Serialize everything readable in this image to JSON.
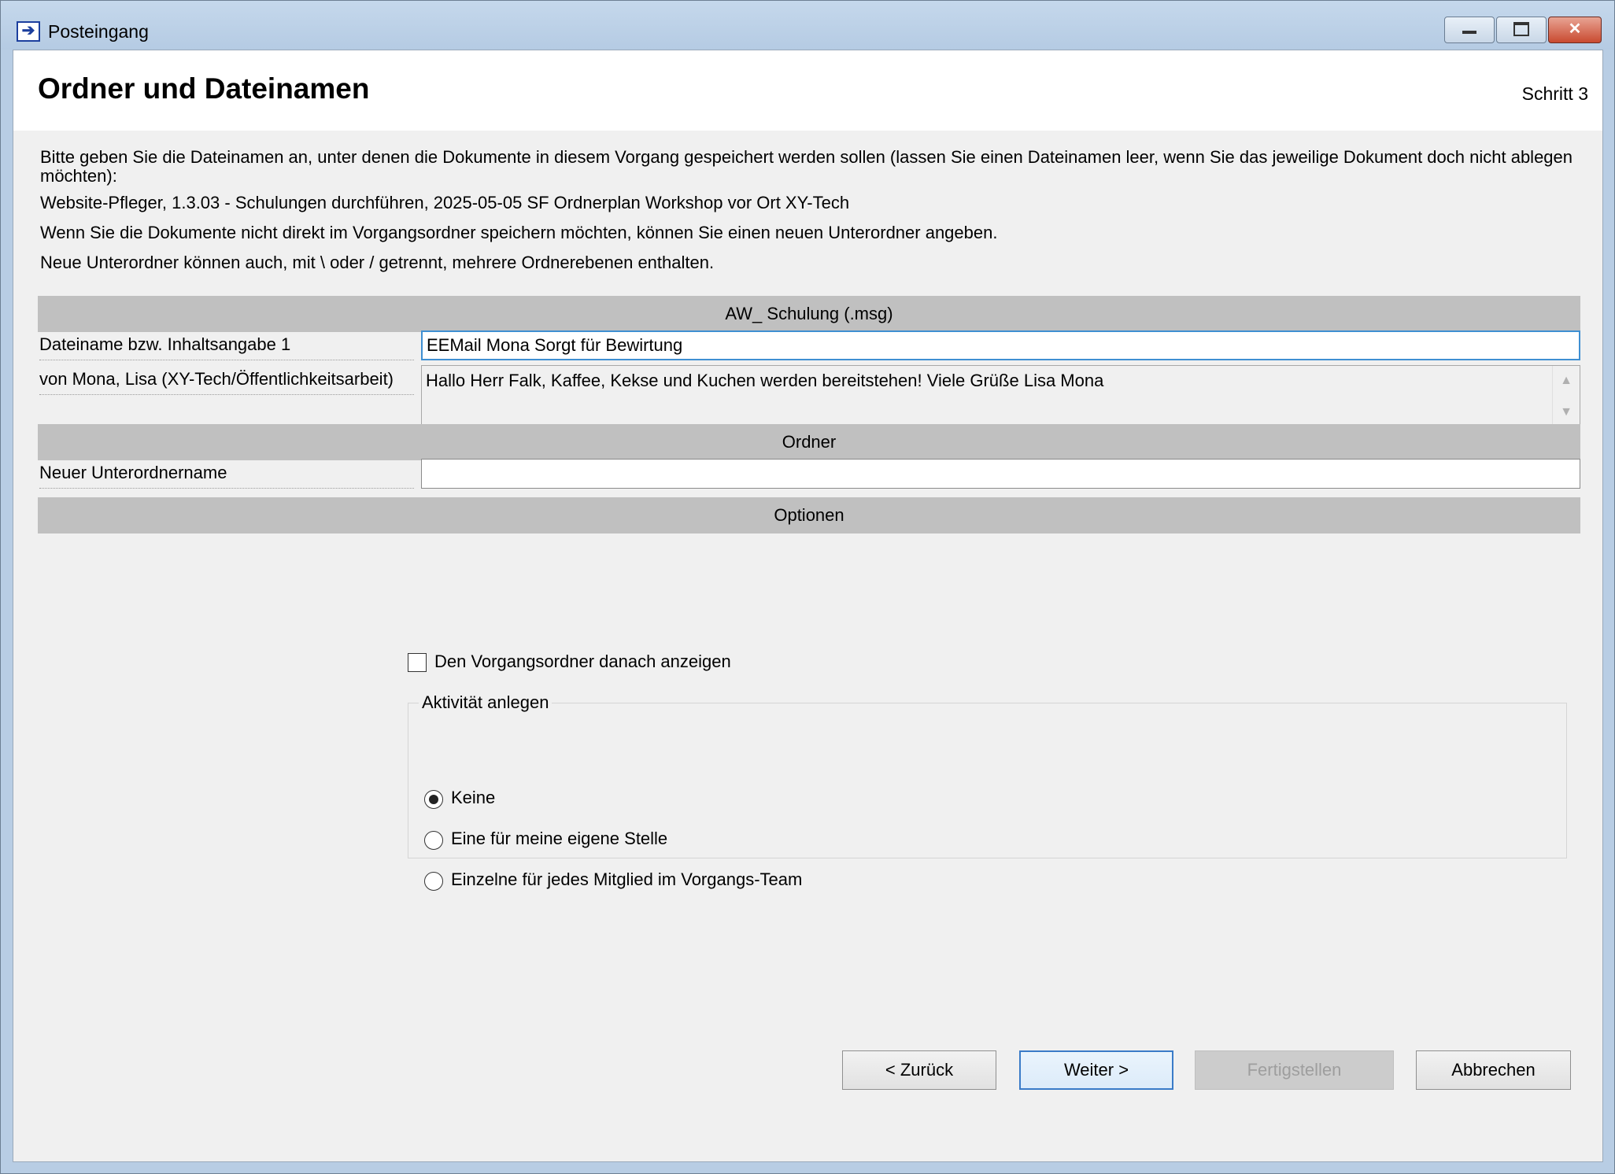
{
  "window": {
    "title": "Posteingang",
    "icon": "inbox-arrow-icon"
  },
  "header": {
    "title": "Ordner und Dateinamen",
    "step": "Schritt 3"
  },
  "info": {
    "line1": "Bitte geben Sie die Dateinamen an, unter denen die Dokumente in diesem Vorgang gespeichert werden sollen (lassen Sie einen Dateinamen leer, wenn Sie das jeweilige Dokument doch nicht ablegen möchten):",
    "line2": "Website-Pfleger, 1.3.03 - Schulungen durchführen, 2025-05-05 SF Ordnerplan Workshop vor Ort XY-Tech",
    "line3": "Wenn Sie die Dokumente nicht direkt im Vorgangsordner speichern möchten, können Sie einen neuen Unterordner angeben.",
    "line4": "Neue Unterordner können auch, mit \\ oder / getrennt, mehrere Ordnerebenen enthalten."
  },
  "document_section": {
    "header": "AW_ Schulung (.msg)",
    "filename_label": "Dateiname bzw. Inhaltsangabe 1",
    "filename_value": "EEMail Mona Sorgt für Bewirtung",
    "sender_label": "von Mona, Lisa (XY-Tech/Öffentlichkeitsarbeit)",
    "message_text": "Hallo Herr Falk, Kaffee, Kekse und Kuchen werden bereitstehen! Viele Grüße Lisa Mona"
  },
  "folder_section": {
    "header": "Ordner",
    "subfolder_label": "Neuer Unterordnername",
    "subfolder_value": ""
  },
  "options_section": {
    "header": "Optionen",
    "show_folder_label": "Den Vorgangsordner danach anzeigen",
    "show_folder_checked": false,
    "activity_group_label": "Aktivität anlegen",
    "activity_options": [
      {
        "label": "Keine",
        "checked": true
      },
      {
        "label": "Eine für meine eigene Stelle",
        "checked": false
      },
      {
        "label": "Einzelne für jedes Mitglied im Vorgangs-Team",
        "checked": false
      }
    ]
  },
  "buttons": {
    "back": "< Zurück",
    "next": "Weiter >",
    "finish": "Fertigstellen",
    "cancel": "Abbrechen"
  },
  "colors": {
    "section_bar": "#c0c0c0",
    "focus_border": "#3f8fd2",
    "client_bg": "#f0f0f0"
  }
}
